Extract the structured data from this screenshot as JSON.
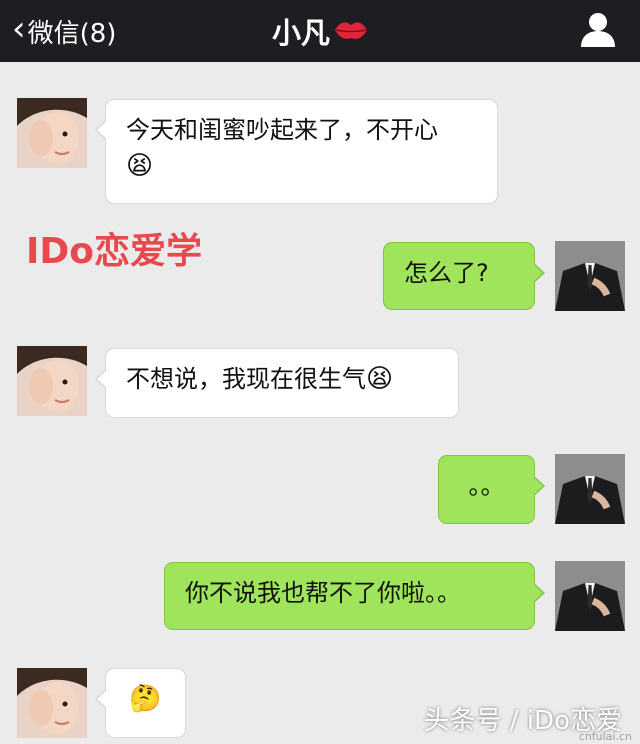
{
  "header": {
    "back_label": "微信(8)",
    "title": "小凡",
    "title_icon": "lips-kiss-icon"
  },
  "watermark": {
    "brand": "IDo恋爱学",
    "footer": "头条号 / iDo恋爱",
    "site": "cnfulai.cn"
  },
  "messages": [
    {
      "side": "in",
      "text": "今天和闺蜜吵起来了，不开心",
      "emoji": "😫"
    },
    {
      "side": "out",
      "text": "怎么了?"
    },
    {
      "side": "in",
      "text": "不想说，我现在很生气",
      "emoji": "😫"
    },
    {
      "side": "out",
      "text": "。。"
    },
    {
      "side": "out",
      "text": "你不说我也帮不了你啦。。"
    },
    {
      "side": "in",
      "text": "",
      "emoji": "🤔"
    }
  ],
  "colors": {
    "header_bg": "#1e1e22",
    "chat_bg": "#ebebeb",
    "outgoing_bubble": "#9fe45a",
    "incoming_bubble": "#ffffff",
    "brand": "#e8494d"
  }
}
